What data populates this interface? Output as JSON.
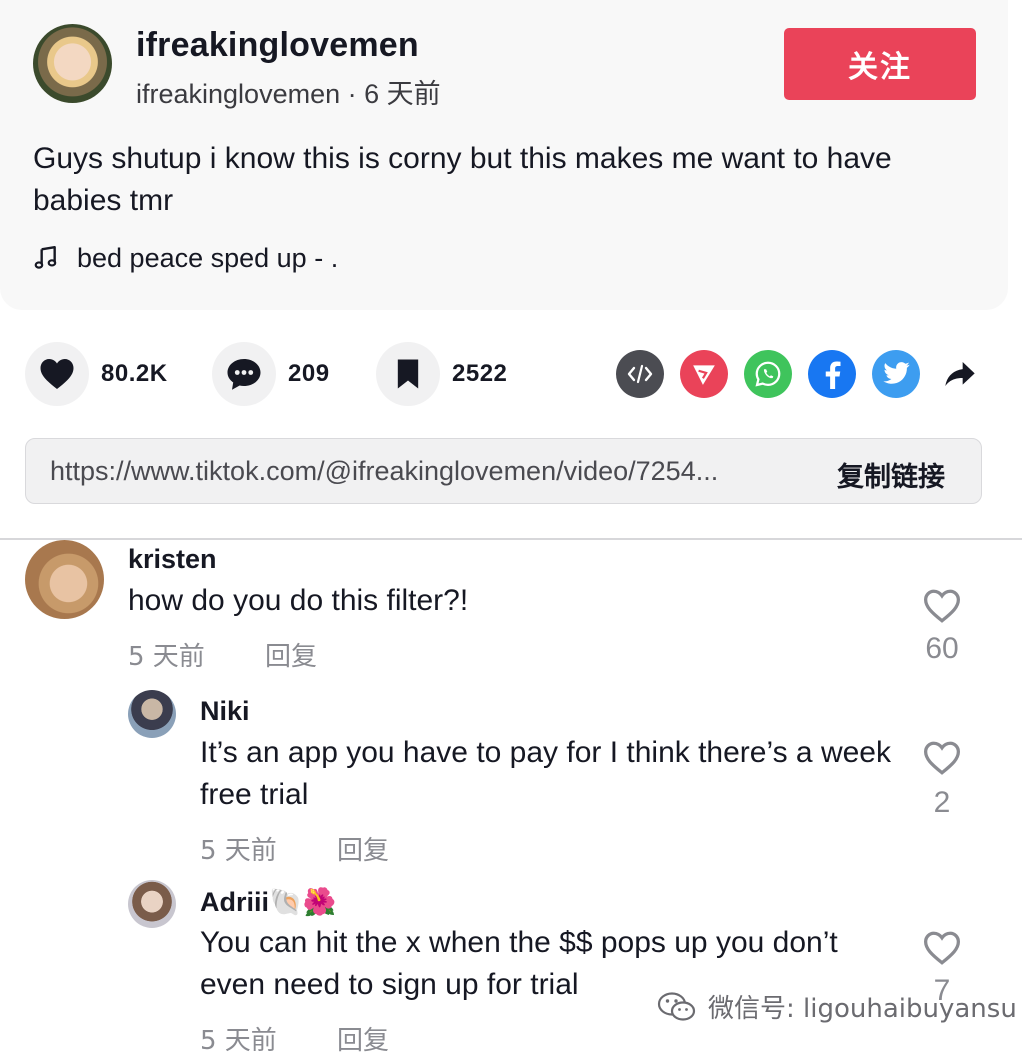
{
  "post": {
    "author_name": "ifreakinglovemen",
    "author_meta": "ifreakinglovemen · 6 天前",
    "follow_label": "关注",
    "caption": "Guys shutup i know this is corny but this makes me want to have babies tmr",
    "music": "bed peace sped up - ."
  },
  "actions": {
    "likes": "80.2K",
    "comments": "209",
    "saves": "2522"
  },
  "share": {
    "icons": [
      "embed-icon",
      "send-icon",
      "whatsapp-icon",
      "facebook-icon",
      "twitter-icon",
      "share-arrow-icon"
    ],
    "colors": {
      "embed": "#4b4c52",
      "send": "#ea4359",
      "whatsapp": "#3fc45c",
      "facebook": "#1877f2",
      "twitter": "#3d9df0"
    }
  },
  "link": {
    "url": "https://www.tiktok.com/@ifreakinglovemen/video/7254...",
    "copy_label": "复制链接"
  },
  "comments": [
    {
      "name": "kristen",
      "text": "how do you do this filter?!",
      "time": "5 天前",
      "reply_label": "回复",
      "likes": "60"
    },
    {
      "name": "Niki",
      "text": "It’s an app you have to pay for I think there’s a week free trial",
      "time": "5 天前",
      "reply_label": "回复",
      "likes": "2"
    },
    {
      "name": "Adriii🐚🌺",
      "text": "You can hit the x when the $$ pops up you don’t even need to sign up for trial",
      "time": "5 天前",
      "reply_label": "回复",
      "likes": "7"
    }
  ],
  "watermark": "微信号: ligouhaibuyansu",
  "accent": "#ea4359"
}
